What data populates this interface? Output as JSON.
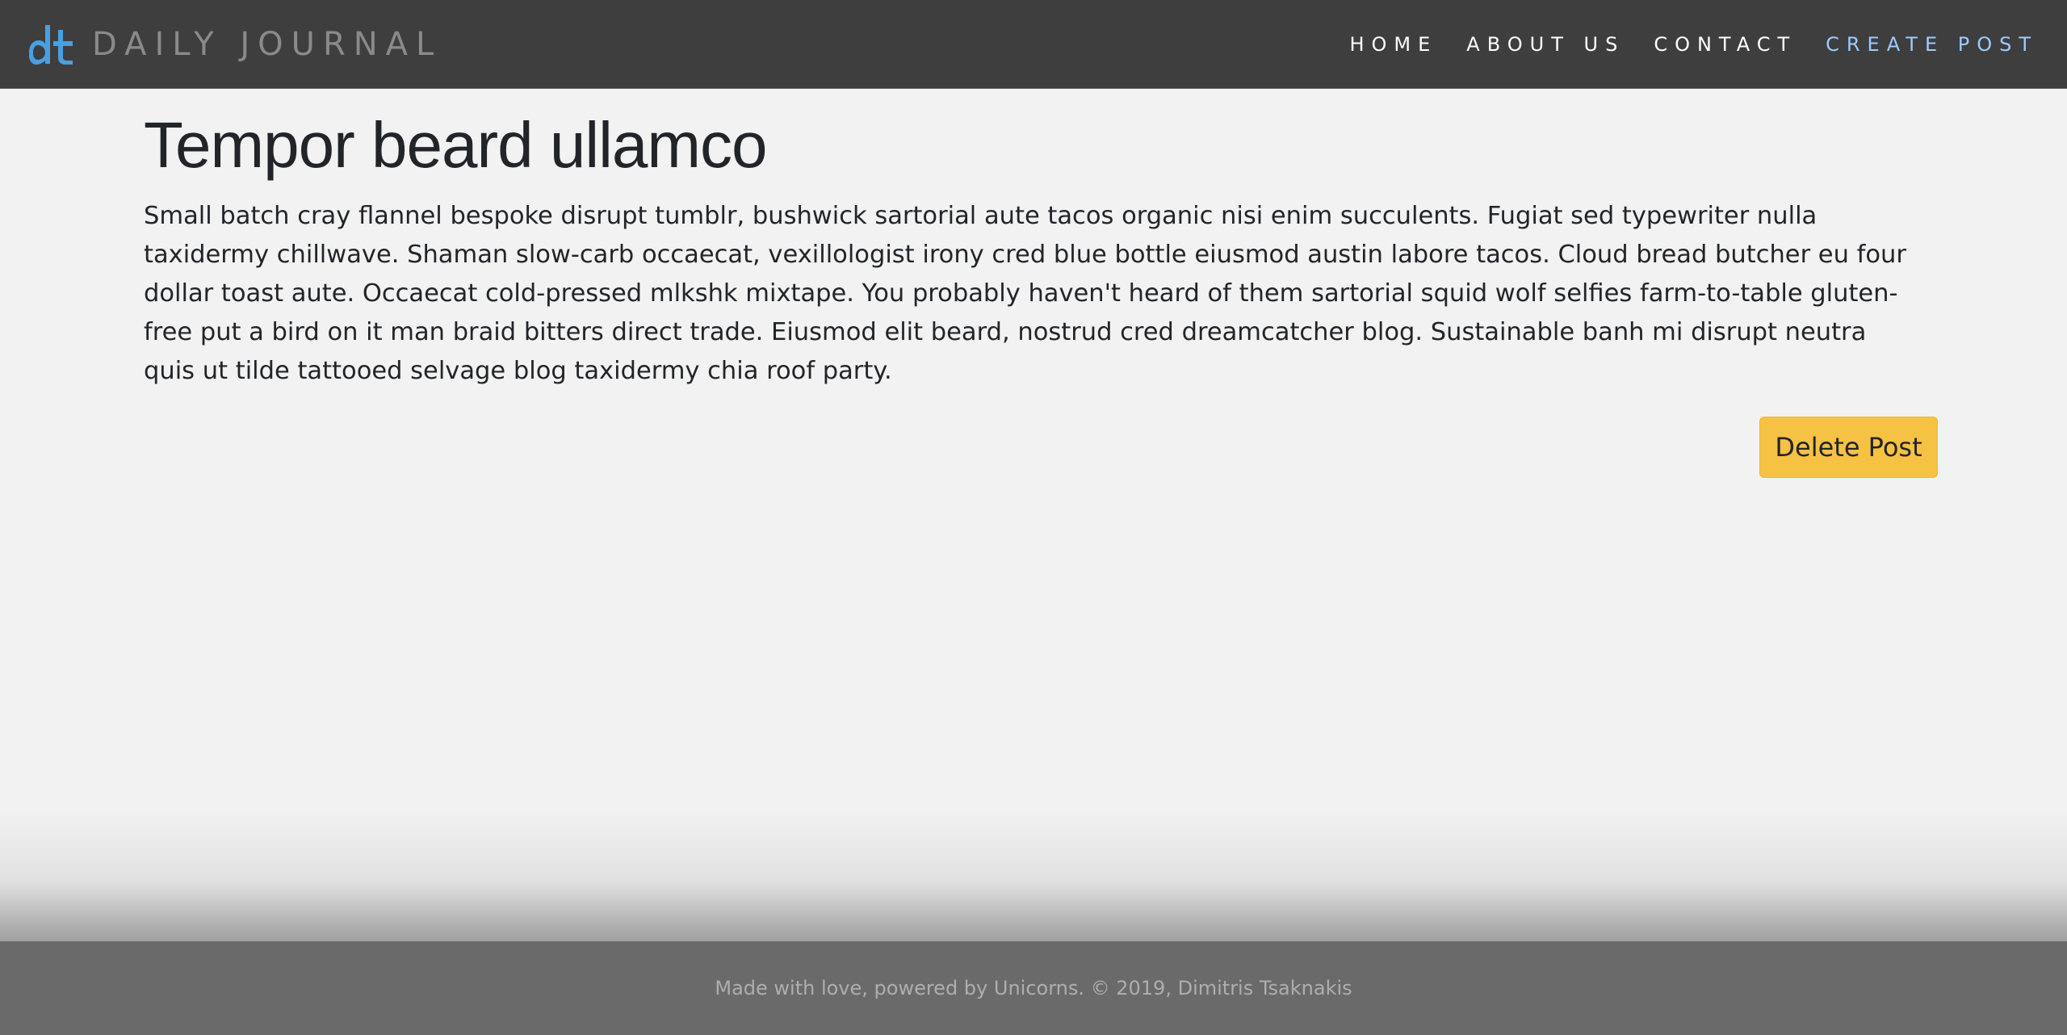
{
  "brand": {
    "logo_icon": "dt-logo-icon",
    "name": "DAILY JOURNAL",
    "logo_color": "#4a9fe0"
  },
  "nav": {
    "items": [
      {
        "label": "HOME"
      },
      {
        "label": "ABOUT US"
      },
      {
        "label": "CONTACT"
      },
      {
        "label": "CREATE POST"
      }
    ],
    "accent_color": "#9ecbff"
  },
  "post": {
    "title": "Tempor beard ullamco",
    "body": "Small batch cray flannel bespoke disrupt tumblr, bushwick sartorial aute tacos organic nisi enim succulents. Fugiat sed typewriter nulla taxidermy chillwave. Shaman slow-carb occaecat, vexillologist irony cred blue bottle eiusmod austin labore tacos. Cloud bread butcher eu four dollar toast aute. Occaecat cold-pressed mlkshk mixtape. You probably haven't heard of them sartorial squid wolf selfies farm-to-table gluten-free put a bird on it man braid bitters direct trade. Eiusmod elit beard, nostrud cred dreamcatcher blog. Sustainable banh mi disrupt neutra quis ut tilde tattooed selvage blog taxidermy chia roof party.",
    "delete_label": "Delete Post",
    "delete_color": "#f6c244"
  },
  "footer": {
    "text": "Made with love, powered by Unicorns. © 2019, Dimitris Tsaknakis"
  }
}
